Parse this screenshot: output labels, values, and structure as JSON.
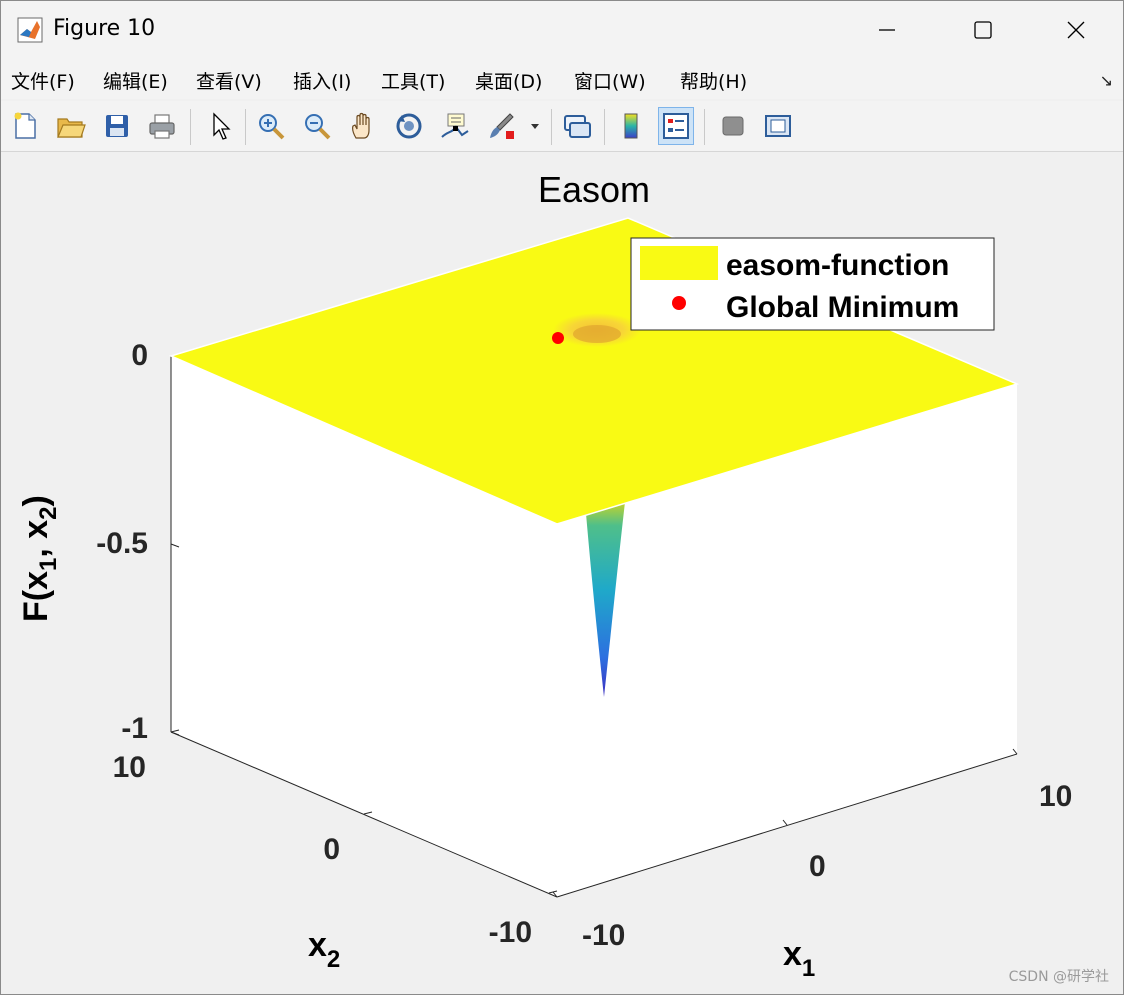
{
  "window": {
    "title": "Figure 10",
    "icon": "matlab-logo-icon",
    "controls": [
      "minimize-icon",
      "maximize-icon",
      "close-icon"
    ]
  },
  "menubar": {
    "items": [
      {
        "label": "文件(F)"
      },
      {
        "label": "编辑(E)"
      },
      {
        "label": "查看(V)"
      },
      {
        "label": "插入(I)"
      },
      {
        "label": "工具(T)"
      },
      {
        "label": "桌面(D)"
      },
      {
        "label": "窗口(W)"
      },
      {
        "label": "帮助(H)"
      }
    ],
    "dock_arrow": "↘"
  },
  "toolbar": {
    "buttons": [
      "new-figure-icon",
      "open-file-icon",
      "save-icon",
      "print-icon",
      "edit-plot-arrow-icon",
      "zoom-in-icon",
      "zoom-out-icon",
      "pan-hand-icon",
      "rotate-3d-icon",
      "data-cursor-icon",
      "brush-icon",
      "brush-dropdown-icon",
      "link-plot-icon",
      "insert-colorbar-icon",
      "insert-legend-icon",
      "hide-plot-tools-icon",
      "show-plot-tools-icon"
    ],
    "active_button": "insert-legend-icon"
  },
  "chart_data": {
    "type": "surface3d",
    "title": "Easom",
    "xlabel": "x",
    "xlabel_sub": "1",
    "ylabel": "x",
    "ylabel_sub": "2",
    "zlabel": "F(x",
    "zlabel_sub1": "1",
    "zlabel_mid": ", x",
    "zlabel_sub2": "2",
    "zlabel_end": ")",
    "xlim": [
      -10,
      10
    ],
    "ylim": [
      -10,
      10
    ],
    "zlim": [
      -1,
      0
    ],
    "xticks": [
      "-10",
      "0",
      "10"
    ],
    "yticks": [
      "-10",
      "0",
      "10"
    ],
    "zticks": [
      "-1",
      "-0.5",
      "0"
    ],
    "surface": {
      "name": "easom-function",
      "function": "-cos(x1)*cos(x2)*exp(-((x1-pi)^2+(x2-pi)^2))",
      "colormap": "parula",
      "minimum_value": -1
    },
    "global_minimum": {
      "name": "Global Minimum",
      "x1": 3.1416,
      "x2": 3.1416,
      "value": -1,
      "color": "#ff0000"
    },
    "legend": {
      "placement": "top-right",
      "entries": [
        "easom-function",
        "Global Minimum"
      ]
    },
    "grid": false
  },
  "watermark": "CSDN @研学社",
  "colors": {
    "surface_flat": "#f9fa14",
    "minimum_marker": "#ff0000",
    "figure_bg": "#f0f0f0",
    "axes_bg": "#ffffff",
    "active_tool_bg": "#cde3f7"
  }
}
